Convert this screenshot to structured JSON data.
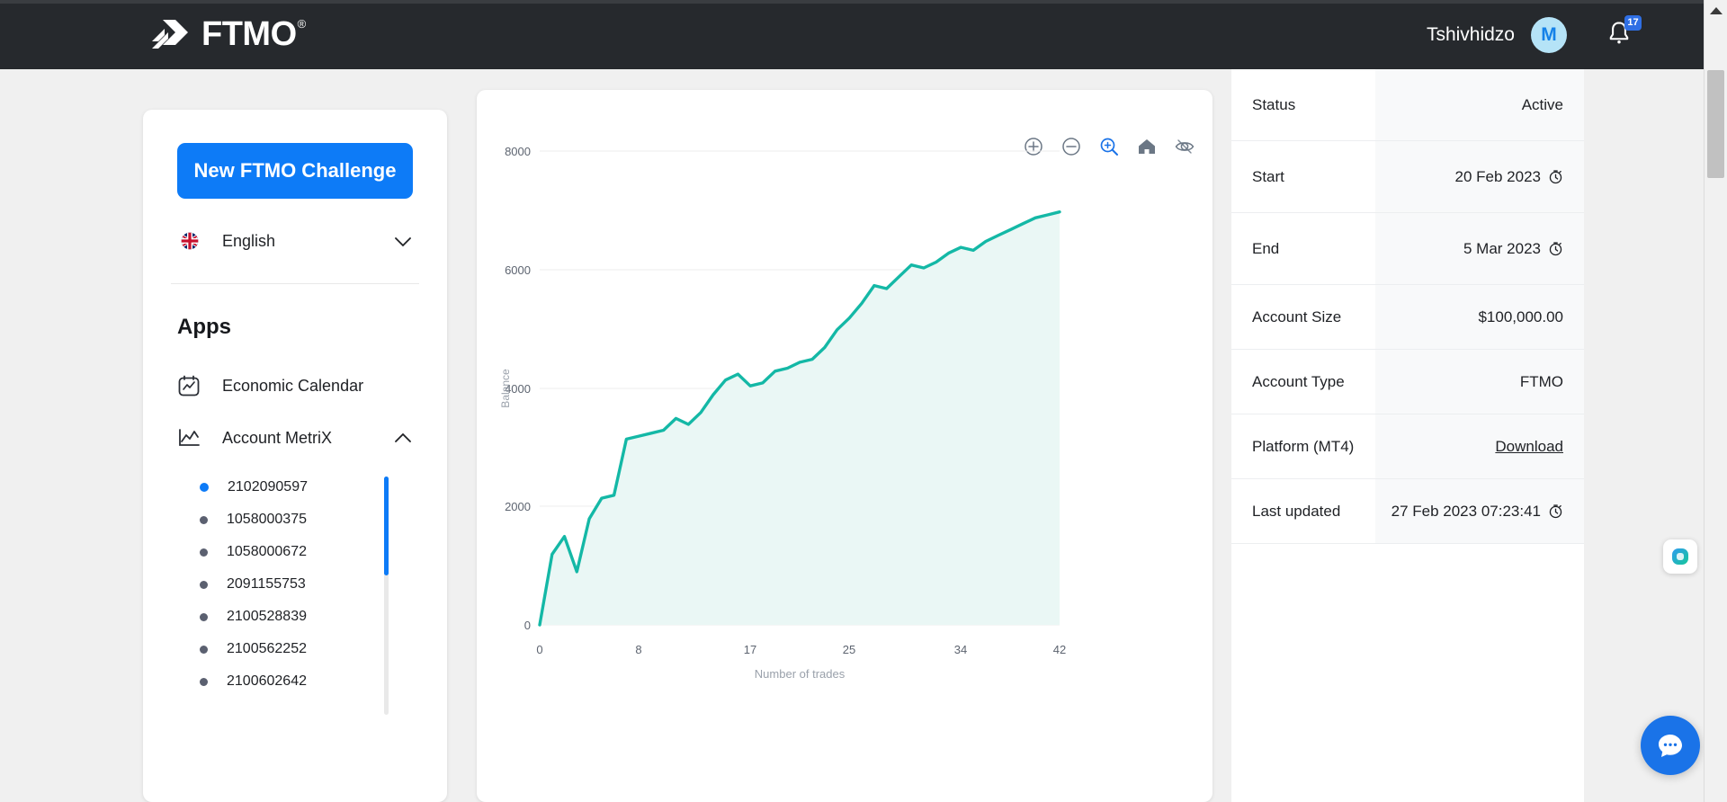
{
  "header": {
    "logo_text": "FTMO",
    "logo_reg": "®",
    "username": "Tshivhidzo",
    "avatar_initial": "M",
    "notification_count": "17",
    "bg_color": "#26292d"
  },
  "sidebar": {
    "challenge_button": "New FTMO Challenge",
    "language": "English",
    "apps_heading": "Apps",
    "nav": [
      {
        "label": "Economic Calendar",
        "icon": "calendar-chart-icon"
      },
      {
        "label": "Account MetriX",
        "icon": "line-chart-icon"
      }
    ],
    "accounts": [
      {
        "number": "2102090597",
        "active": true
      },
      {
        "number": "1058000375",
        "active": false
      },
      {
        "number": "1058000672",
        "active": false
      },
      {
        "number": "2091155753",
        "active": false
      },
      {
        "number": "2100528839",
        "active": false
      },
      {
        "number": "2100562252",
        "active": false
      },
      {
        "number": "2100602642",
        "active": false
      }
    ]
  },
  "chart_tools": [
    {
      "name": "zoom-in-icon",
      "active": false
    },
    {
      "name": "zoom-out-icon",
      "active": false
    },
    {
      "name": "zoom-select-icon",
      "active": true
    },
    {
      "name": "home-icon",
      "active": false
    },
    {
      "name": "pan-eye-icon",
      "active": false
    }
  ],
  "chart_data": {
    "type": "area",
    "title": "",
    "xlabel": "Number of trades",
    "ylabel": "Balance",
    "xticks": [
      0,
      8,
      17,
      25,
      34,
      42
    ],
    "yticks": [
      0,
      2000,
      4000,
      6000,
      8000
    ],
    "xlim": [
      0,
      42
    ],
    "ylim": [
      0,
      8000
    ],
    "grid": true,
    "line_color": "#14b8a6",
    "fill_color": "#eaf7f5",
    "x": [
      0,
      1,
      2,
      3,
      4,
      5,
      6,
      7,
      8,
      9,
      10,
      11,
      12,
      13,
      14,
      15,
      16,
      17,
      18,
      19,
      20,
      21,
      22,
      23,
      24,
      25,
      26,
      27,
      28,
      29,
      30,
      31,
      32,
      33,
      34,
      35,
      36,
      37,
      38,
      39,
      40,
      41,
      42
    ],
    "values": [
      0,
      1200,
      1500,
      900,
      1800,
      2150,
      2200,
      3150,
      3200,
      3250,
      3300,
      3500,
      3400,
      3600,
      3900,
      4150,
      4250,
      4050,
      4100,
      4300,
      4350,
      4450,
      4500,
      4700,
      5000,
      5200,
      5450,
      5750,
      5700,
      5900,
      6100,
      6050,
      6150,
      6300,
      6400,
      6350,
      6500,
      6600,
      6700,
      6800,
      6900,
      6950,
      7000
    ]
  },
  "info": {
    "rows": [
      {
        "label": "Status",
        "value": "Active",
        "icon": null,
        "link": false
      },
      {
        "label": "Start",
        "value": "20 Feb 2023",
        "icon": "stopwatch-icon",
        "link": false
      },
      {
        "label": "End",
        "value": "5 Mar 2023",
        "icon": "stopwatch-icon",
        "link": false
      },
      {
        "label": "Account Size",
        "value": "$100,000.00",
        "icon": null,
        "link": false
      },
      {
        "label": "Account Type",
        "value": "FTMO",
        "icon": null,
        "link": false
      },
      {
        "label": "Platform (MT4)",
        "value": "Download",
        "icon": null,
        "link": true
      },
      {
        "label": "Last updated",
        "value": "27 Feb 2023 07:23:41",
        "icon": "stopwatch-icon",
        "link": false
      }
    ]
  },
  "colors": {
    "accent_blue": "#0d7bf7",
    "teal": "#14b8a6",
    "dark": "#26292d"
  }
}
